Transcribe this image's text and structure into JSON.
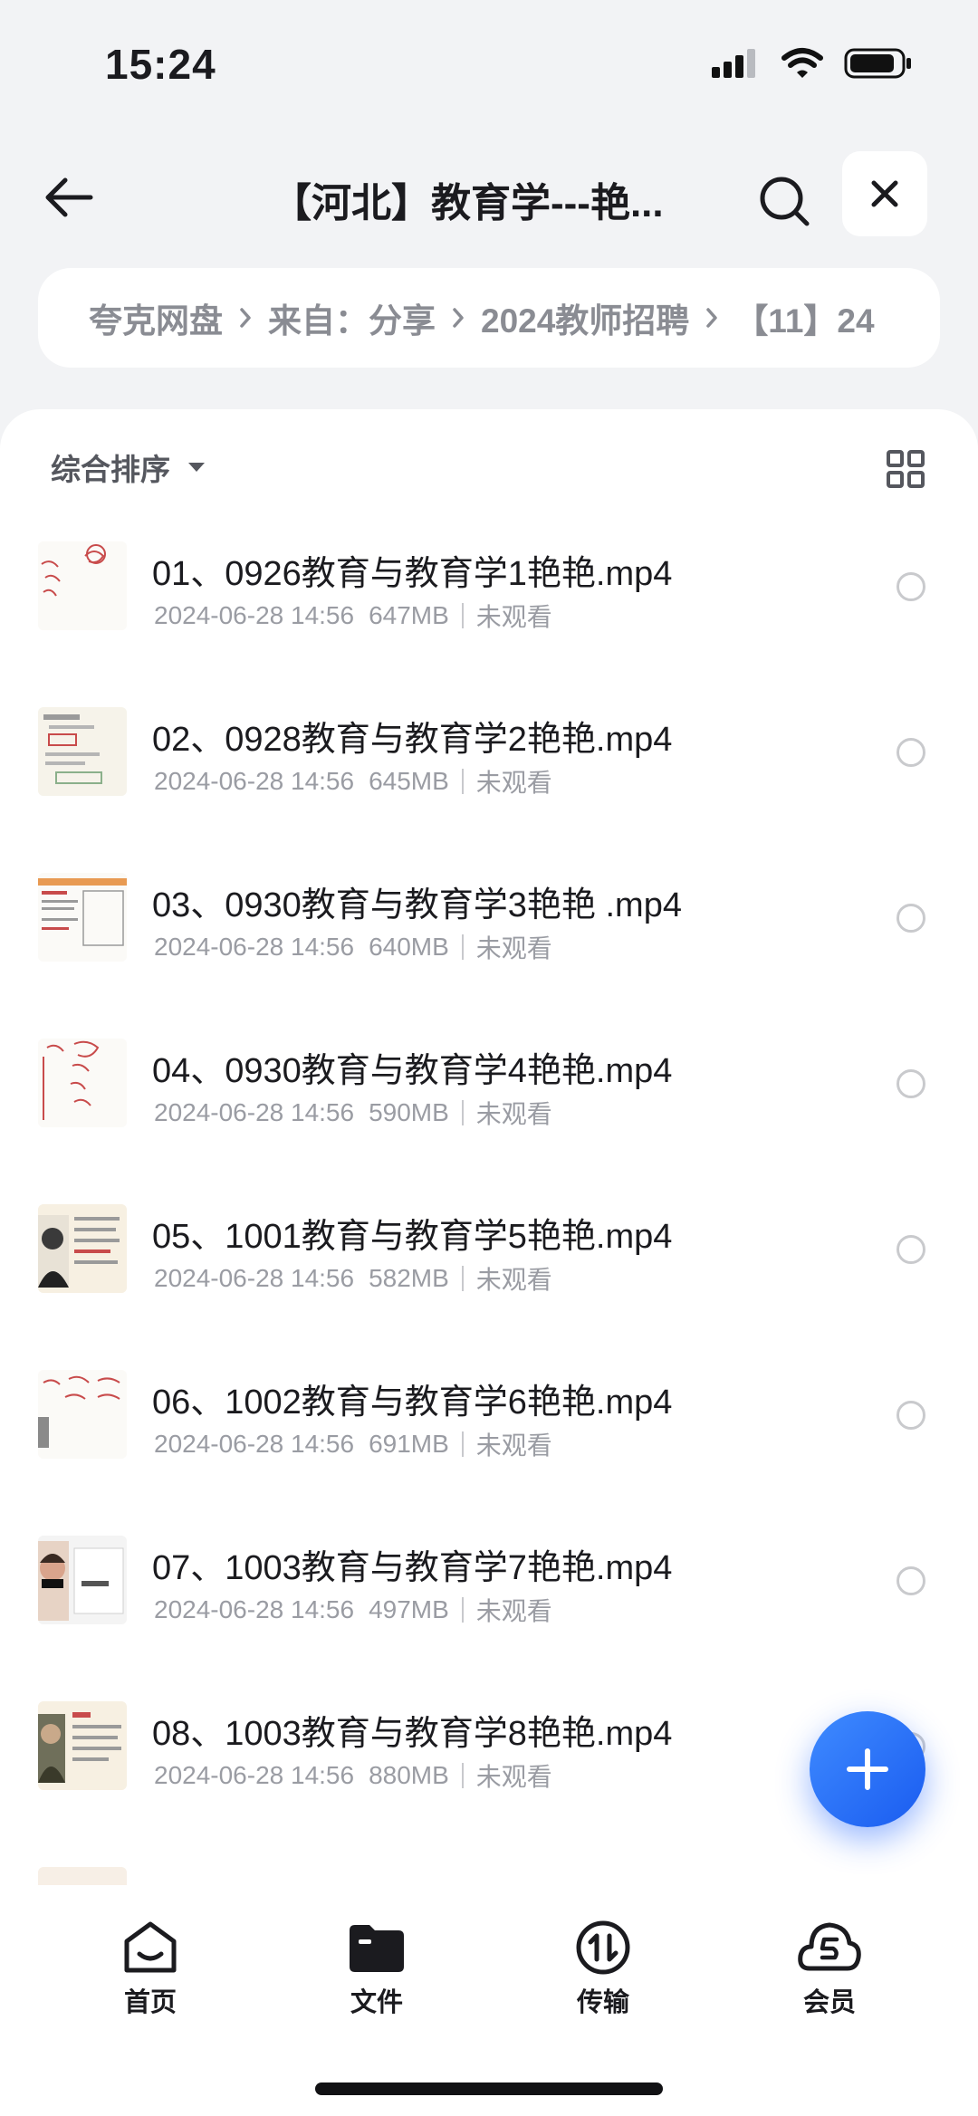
{
  "status_bar": {
    "time": "15:24"
  },
  "nav": {
    "title": "【河北】教育学---艳..."
  },
  "breadcrumb": [
    "夸克网盘",
    "来自：分享",
    "2024教师招聘",
    "【11】24"
  ],
  "sort": {
    "label": "综合排序"
  },
  "files": [
    {
      "name": "01、0926教育与教育学1艳艳.mp4",
      "date": "2024-06-28 14:56",
      "size": "647MB",
      "status": "未观看"
    },
    {
      "name": "02、0928教育与教育学2艳艳.mp4",
      "date": "2024-06-28 14:56",
      "size": "645MB",
      "status": "未观看"
    },
    {
      "name": "03、0930教育与教育学3艳艳 .mp4",
      "date": "2024-06-28 14:56",
      "size": "640MB",
      "status": "未观看"
    },
    {
      "name": "04、0930教育与教育学4艳艳.mp4",
      "date": "2024-06-28 14:56",
      "size": "590MB",
      "status": "未观看"
    },
    {
      "name": "05、1001教育与教育学5艳艳.mp4",
      "date": "2024-06-28 14:56",
      "size": "582MB",
      "status": "未观看"
    },
    {
      "name": "06、1002教育与教育学6艳艳.mp4",
      "date": "2024-06-28 14:56",
      "size": "691MB",
      "status": "未观看"
    },
    {
      "name": "07、1003教育与教育学7艳艳.mp4",
      "date": "2024-06-28 14:56",
      "size": "497MB",
      "status": "未观看"
    },
    {
      "name": "08、1003教育与教育学8艳艳.mp4",
      "date": "2024-06-28 14:56",
      "size": "880MB",
      "status": "未观看"
    }
  ],
  "tabs": [
    {
      "label": "首页",
      "icon": "home-icon"
    },
    {
      "label": "文件",
      "icon": "folder-icon"
    },
    {
      "label": "传输",
      "icon": "transfer-icon"
    },
    {
      "label": "会员",
      "icon": "member-icon"
    }
  ],
  "colors": {
    "accent": "#1a5cf0",
    "background": "#f2f3f5",
    "text": "#1b1b1f",
    "muted": "#9a9ca3"
  }
}
